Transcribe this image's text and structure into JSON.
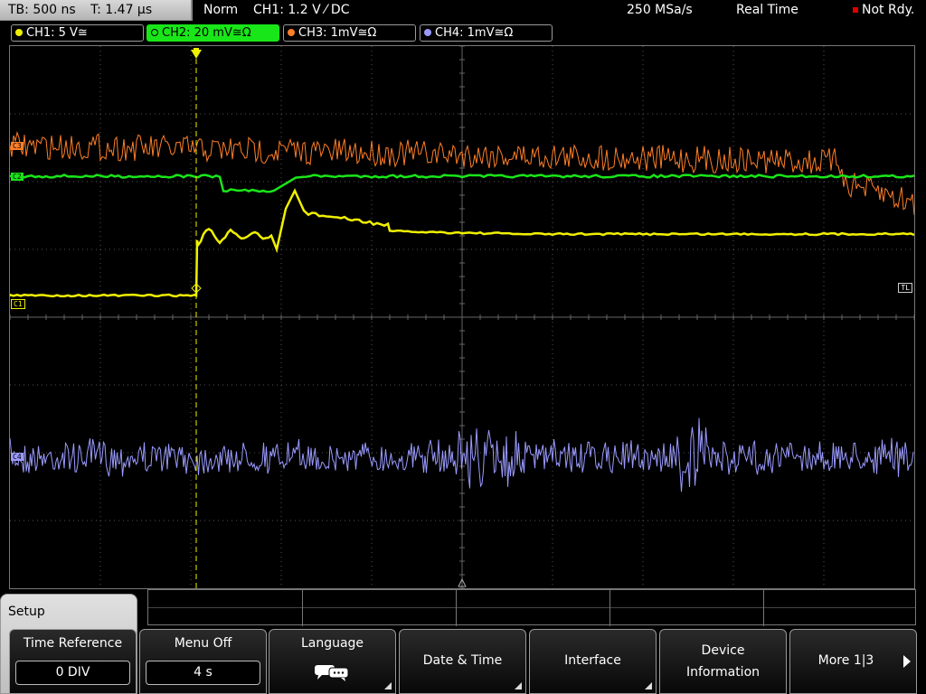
{
  "topbar": {
    "timebase": "TB: 500 ns",
    "trigger_time": "T: 1.47 µs",
    "mode": "Norm",
    "trigger_setting": "CH1: 1.2 V ⁄ DC",
    "sample_rate": "250 MSa/s",
    "acquisition": "Real Time",
    "status": "Not Rdy."
  },
  "channels": [
    {
      "label": "CH1: 5 V≅",
      "color": "#f0f000",
      "active": false
    },
    {
      "label": "CH2: 20 mV≅Ω",
      "color": "#19e619",
      "active": true
    },
    {
      "label": "CH3: 1mV≅Ω",
      "color": "#ff7f27",
      "active": false
    },
    {
      "label": "CH4: 1mV≅Ω",
      "color": "#9a9aff",
      "active": false
    }
  ],
  "screen": {
    "markers": {
      "c3": "C3",
      "c2": "C2",
      "c1": "C1",
      "c4": "C4",
      "trigger_level": "TL"
    }
  },
  "menu": {
    "title": "Setup",
    "softkeys": [
      {
        "label": "Time Reference",
        "value": "0 DIV"
      },
      {
        "label": "Menu Off",
        "value": "4 s"
      },
      {
        "label": "Language",
        "icon": "speech-bubble-icon"
      },
      {
        "label": "Date & Time"
      },
      {
        "label": "Interface"
      },
      {
        "label": "Device\nInformation",
        "line1": "Device",
        "line2": "Information"
      },
      {
        "label": "More 1|3"
      }
    ]
  },
  "colors": {
    "ch1": "#f0f000",
    "ch2": "#19e619",
    "ch3": "#ff7f27",
    "ch4": "#9a9aff",
    "grid": "#555555"
  }
}
